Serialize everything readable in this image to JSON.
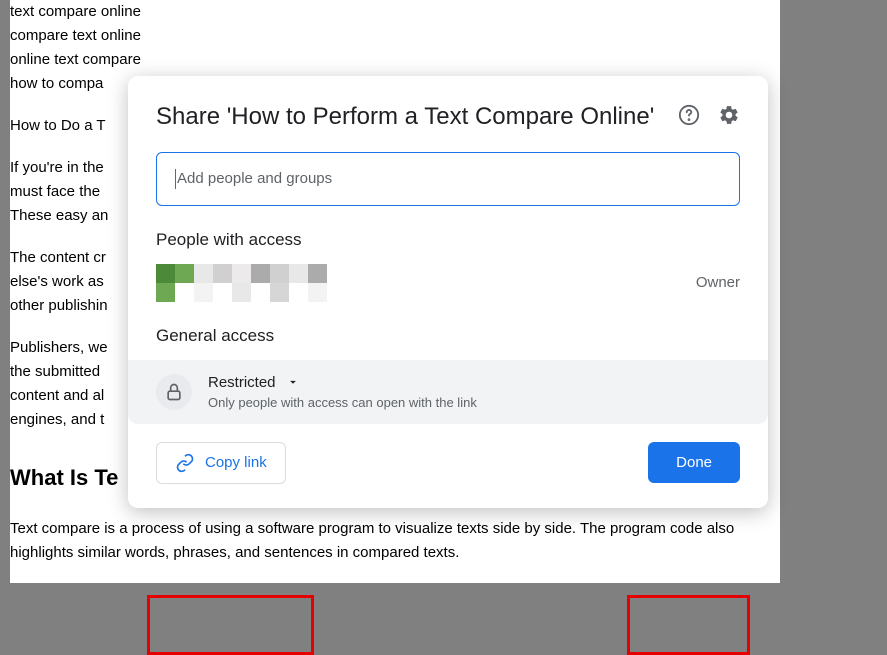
{
  "background": {
    "lines": [
      "text compare online",
      "compare text online",
      "online text compare",
      "how to compa"
    ],
    "para1": "How to Do a T",
    "para2": "If you're in the\nmust face the\nThese easy an",
    "para3": "The content cr\nelse's work as\nother publishin",
    "para4": "Publishers, we\nthe submitted\ncontent and al\nengines, and t",
    "heading": "What Is Te",
    "para5": "Text compare is a process of using a software program to visualize texts side by side. The program code also highlights similar words, phrases, and sentences in compared texts."
  },
  "dialog": {
    "title": "Share 'How to Perform a Text Compare Online'",
    "input_placeholder": "Add people and groups",
    "people_section": "People with access",
    "owner_role": "Owner",
    "general_section": "General access",
    "restricted_label": "Restricted",
    "restricted_desc": "Only people with access can open with the link",
    "copy_link": "Copy link",
    "done": "Done"
  },
  "avatar_pixels": [
    "#4c8a3a",
    "#6fa852",
    "#e8e8e8",
    "#d0d0d0",
    "#eceaea",
    "#ababab",
    "#d0d0d0",
    "#e8e8e8",
    "#ababab",
    "#ffffff",
    "#6fa852",
    "#ffffff",
    "#f3f3f3",
    "#ffffff",
    "#e8e8e8",
    "#ffffff",
    "#d6d6d6",
    "#ffffff",
    "#f3f3f3",
    "#ffffff"
  ]
}
